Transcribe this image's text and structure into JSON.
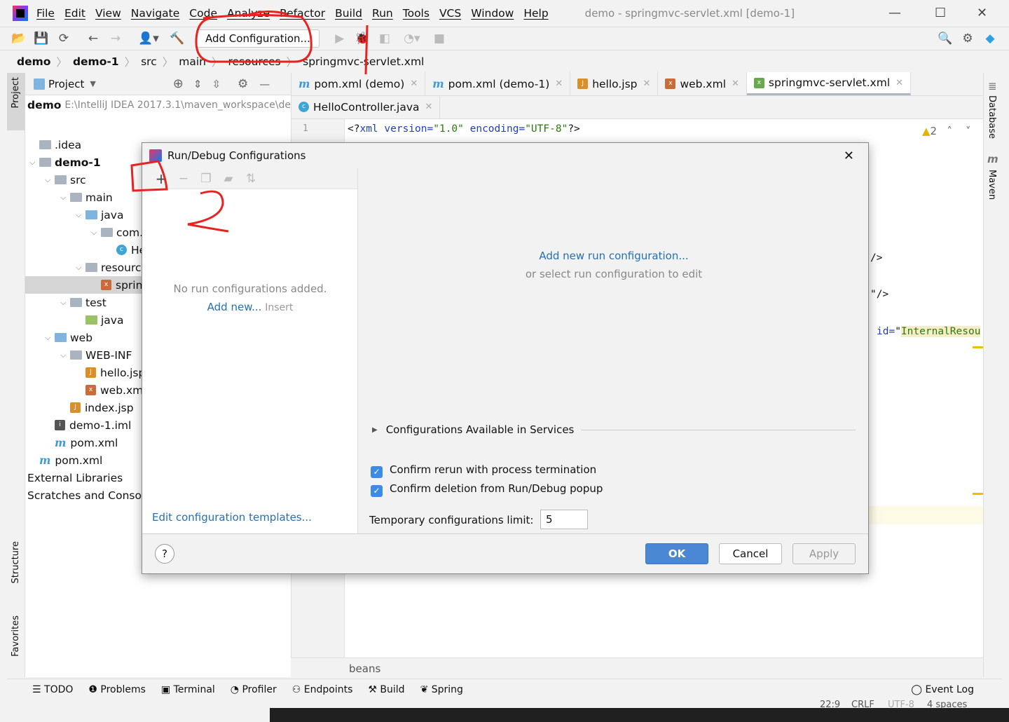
{
  "menubar": {
    "items": [
      "File",
      "Edit",
      "View",
      "Navigate",
      "Code",
      "Analyze",
      "Refactor",
      "Build",
      "Run",
      "Tools",
      "VCS",
      "Window",
      "Help"
    ],
    "window_title": "demo - springmvc-servlet.xml [demo-1]"
  },
  "toolbar": {
    "add_configuration": "Add Configuration..."
  },
  "breadcrumb": [
    "demo",
    "demo-1",
    "src",
    "main",
    "resources",
    "springmvc-servlet.xml"
  ],
  "left_strip": {
    "project": "Project",
    "structure": "Structure",
    "favorites": "Favorites"
  },
  "project": {
    "header": "Project",
    "root": "demo",
    "root_path": "E:\\IntelliJ IDEA 2017.3.1\\maven_workspace\\de",
    "tree": [
      {
        "label": ".idea",
        "depth": 0,
        "kind": "folder"
      },
      {
        "label": "demo-1",
        "depth": 0,
        "kind": "folder",
        "bold": true
      },
      {
        "label": "src",
        "depth": 1,
        "kind": "folder"
      },
      {
        "label": "main",
        "depth": 2,
        "kind": "folder"
      },
      {
        "label": "java",
        "depth": 3,
        "kind": "src"
      },
      {
        "label": "com.xx",
        "depth": 4,
        "kind": "package"
      },
      {
        "label": "Hell",
        "depth": 5,
        "kind": "class"
      },
      {
        "label": "resources",
        "depth": 3,
        "kind": "res"
      },
      {
        "label": "springr",
        "depth": 4,
        "kind": "xml",
        "selected": true
      },
      {
        "label": "test",
        "depth": 2,
        "kind": "folder"
      },
      {
        "label": "java",
        "depth": 3,
        "kind": "tst"
      },
      {
        "label": "web",
        "depth": 1,
        "kind": "web"
      },
      {
        "label": "WEB-INF",
        "depth": 2,
        "kind": "folder"
      },
      {
        "label": "hello.jsp",
        "depth": 3,
        "kind": "jsp"
      },
      {
        "label": "web.xml",
        "depth": 3,
        "kind": "xml"
      },
      {
        "label": "index.jsp",
        "depth": 2,
        "kind": "jsp"
      },
      {
        "label": "demo-1.iml",
        "depth": 1,
        "kind": "iml"
      },
      {
        "label": "pom.xml",
        "depth": 1,
        "kind": "maven"
      },
      {
        "label": "pom.xml",
        "depth": 0,
        "kind": "maven"
      },
      {
        "label": "External Libraries",
        "depth": -1,
        "kind": "none"
      },
      {
        "label": "Scratches and Console",
        "depth": -1,
        "kind": "none"
      }
    ]
  },
  "editor": {
    "tabs": [
      "pom.xml (demo)",
      "pom.xml (demo-1)",
      "hello.jsp",
      "web.xml",
      "springmvc-servlet.xml"
    ],
    "tabs2": [
      "HelloController.java"
    ],
    "line_number": "1",
    "line1": {
      "a": "<?",
      "b": "xml version=",
      "c": "\"1.0\"",
      "d": " encoding=",
      "e": "\"UTF-8\"",
      "f": "?>"
    },
    "frag1": "/>",
    "frag2": "\"/>",
    "frag3a": "id=",
    "frag3b": "\"",
    "frag3c": "InternalResou",
    "warnings": "2",
    "footer": "beans"
  },
  "right_strip": {
    "database": "Database",
    "maven": "Maven"
  },
  "dialog": {
    "title": "Run/Debug Configurations",
    "no_configs": "No run configurations added.",
    "add_new": "Add new...",
    "insert": "Insert",
    "edit_templates": "Edit configuration templates...",
    "add_new_run": "Add new run configuration...",
    "or_select": "or select run configuration to edit",
    "services": "Configurations Available in Services",
    "confirm_rerun": "Confirm rerun with process termination",
    "confirm_rerun_checked": true,
    "confirm_deletion": "Confirm deletion from Run/Debug popup",
    "confirm_deletion_checked": true,
    "temp_limit_label": "Temporary configurations limit:",
    "temp_limit_value": "5",
    "ok": "OK",
    "cancel": "Cancel",
    "apply": "Apply",
    "help": "?"
  },
  "toolwindows": [
    "TODO",
    "Problems",
    "Terminal",
    "Profiler",
    "Endpoints",
    "Build",
    "Spring"
  ],
  "event_log": "Event Log",
  "status": {
    "pos": "22:9",
    "eol": "CRLF",
    "enc": "UTF-8",
    "indent": "4 spaces"
  },
  "annotations": {
    "step2": "2",
    "color": "#e8231f"
  }
}
